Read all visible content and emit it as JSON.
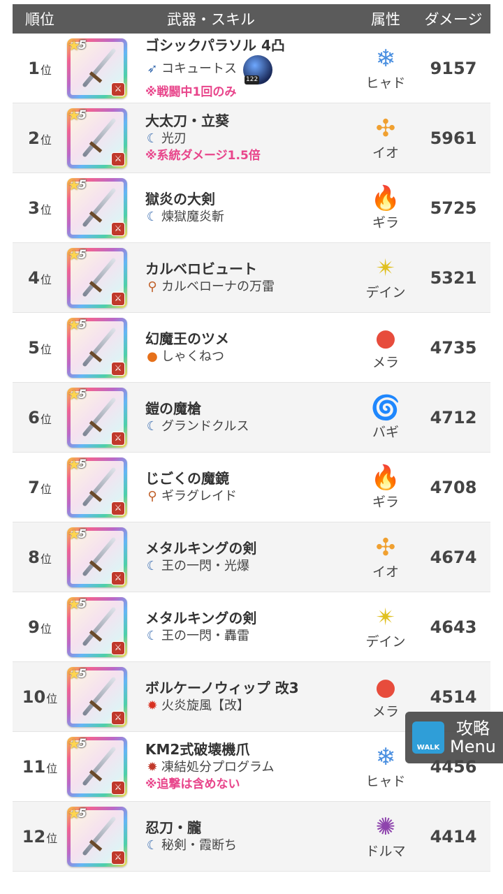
{
  "header": {
    "rank": "順位",
    "weapon_skill": "武器・スキル",
    "attribute": "属性",
    "damage": "ダメージ"
  },
  "rank_suffix": "位",
  "rows": [
    {
      "rank": "1",
      "name": "ゴシックパラソル 4凸",
      "skill_icon": "bow-icon",
      "skill": "コキュートス",
      "note": "※戦闘中1回のみ",
      "orb": "122",
      "attr_icon": "ice-snowflake-icon",
      "attr": "ヒャド",
      "dmg": "9157"
    },
    {
      "rank": "2",
      "name": "大太刀・立葵",
      "skill_icon": "slash-icon",
      "skill": "光刃",
      "note": "※系統ダメージ1.5倍",
      "attr_icon": "explosion-icon",
      "attr": "イオ",
      "dmg": "5961"
    },
    {
      "rank": "3",
      "name": "獄炎の大剣",
      "skill_icon": "slash-icon",
      "skill": "煉獄魔炎斬",
      "note": "",
      "attr_icon": "flame-icon",
      "attr": "ギラ",
      "dmg": "5725"
    },
    {
      "rank": "4",
      "name": "カルベロビュート",
      "skill_icon": "staff-icon",
      "skill": "カルベローナの万雷",
      "note": "",
      "attr_icon": "lightning-star-icon",
      "attr": "デイン",
      "dmg": "5321"
    },
    {
      "rank": "5",
      "name": "幻魔王のツメ",
      "skill_icon": "fire-orb-icon",
      "skill": "しゃくねつ",
      "note": "",
      "attr_icon": "fireball-icon",
      "attr": "メラ",
      "dmg": "4735"
    },
    {
      "rank": "6",
      "name": "鎧の魔槍",
      "skill_icon": "slash-icon",
      "skill": "グランドクルス",
      "note": "",
      "attr_icon": "tornado-icon",
      "attr": "バギ",
      "dmg": "4712"
    },
    {
      "rank": "7",
      "name": "じごくの魔鏡",
      "skill_icon": "staff-icon",
      "skill": "ギラグレイド",
      "note": "",
      "attr_icon": "flame-icon",
      "attr": "ギラ",
      "dmg": "4708"
    },
    {
      "rank": "8",
      "name": "メタルキングの剣",
      "skill_icon": "slash-icon",
      "skill": "王の一閃・光爆",
      "note": "",
      "attr_icon": "explosion-icon",
      "attr": "イオ",
      "dmg": "4674"
    },
    {
      "rank": "9",
      "name": "メタルキングの剣",
      "skill_icon": "slash-icon",
      "skill": "王の一閃・轟雷",
      "note": "",
      "attr_icon": "lightning-star-icon",
      "attr": "デイン",
      "dmg": "4643"
    },
    {
      "rank": "10",
      "name": "ボルケーノウィップ 改3",
      "skill_icon": "fire-swirl-icon",
      "skill": "火炎旋風【改】",
      "note": "",
      "attr_icon": "fireball-icon",
      "attr": "メラ",
      "dmg": "4514"
    },
    {
      "rank": "11",
      "name": "KM2式破壊機爪",
      "skill_icon": "gear-icon",
      "skill": "凍結処分プログラム",
      "note": "※追撃は含めない",
      "attr_icon": "ice-snowflake-icon",
      "attr": "ヒャド",
      "dmg": "4456"
    },
    {
      "rank": "12",
      "name": "忍刀・朧",
      "skill_icon": "slash-icon",
      "skill": "秘剣・霞断ち",
      "note": "",
      "attr_icon": "dark-swirl-icon",
      "attr": "ドルマ",
      "dmg": "4414"
    }
  ],
  "star_level": "5",
  "float_button": {
    "logo": "WALK",
    "line1": "攻略",
    "line2": "Menu"
  },
  "colors": {
    "header_bg": "#5b5b5b",
    "note": "#e8458b"
  }
}
